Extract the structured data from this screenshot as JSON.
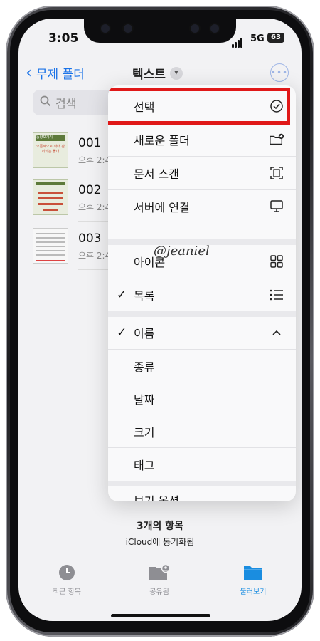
{
  "status": {
    "time": "3:05",
    "network": "5G",
    "battery": "63"
  },
  "nav": {
    "back_label": "무제 폴더",
    "title": "텍스트"
  },
  "search": {
    "placeholder": "검색"
  },
  "files": [
    {
      "name": "001",
      "date": "오후 2:4",
      "thumb_title": "동양포기기",
      "thumb_sub": "오픈적으로 확대 관리되는 폴더"
    },
    {
      "name": "002",
      "date": "오후 2:4"
    },
    {
      "name": "003",
      "date": "오후 2:4"
    }
  ],
  "menu": {
    "items": [
      {
        "label": "선택",
        "icon": "checkmark-circle-icon"
      },
      {
        "label": "새로운 폴더",
        "icon": "folder-plus-icon"
      },
      {
        "label": "문서 스캔",
        "icon": "scan-document-icon"
      },
      {
        "label": "서버에 연결",
        "icon": "display-icon"
      }
    ],
    "view": [
      {
        "label": "아이콘",
        "icon": "grid-icon",
        "checked": false
      },
      {
        "label": "목록",
        "icon": "list-icon",
        "checked": true
      }
    ],
    "sort": [
      {
        "label": "이름",
        "checked": true,
        "icon": "chevron-up-icon"
      },
      {
        "label": "종류"
      },
      {
        "label": "날짜"
      },
      {
        "label": "크기"
      },
      {
        "label": "태그"
      }
    ],
    "options_label": "보기 옵션"
  },
  "watermark": "@jeaniel",
  "footer": {
    "count": "3개의 항목",
    "sync": "iCloud에 동기화됨"
  },
  "tabs": [
    {
      "label": "최근 항목",
      "active": false
    },
    {
      "label": "공유됨",
      "active": false
    },
    {
      "label": "둘러보기",
      "active": true
    }
  ],
  "colors": {
    "accent": "#1a73e8",
    "highlight": "#e01818"
  }
}
